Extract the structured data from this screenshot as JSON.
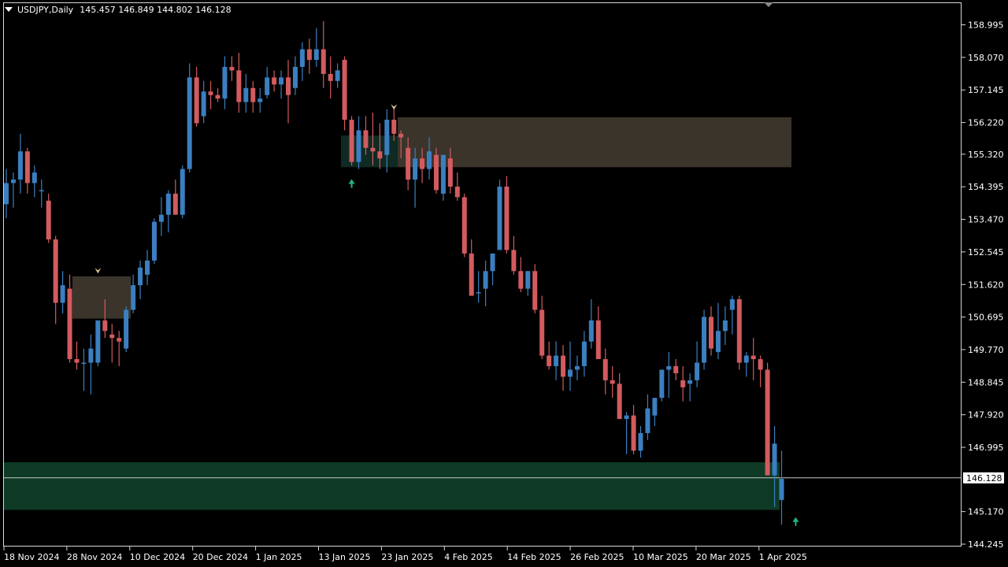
{
  "header": {
    "symbol_tf": "USDJPY,Daily",
    "ohlc": "145.457 146.849 144.802 146.128"
  },
  "colors": {
    "background": "#000000",
    "bull": "#3b7fc0",
    "bear": "#d25b5f",
    "axis": "#d8d8d8",
    "price_line": "#c8c8c8",
    "supply_zone": "#3a342b",
    "demand_zone": "#0e3a25",
    "demand_zone_small": "#0f2a22",
    "up_arrow": "#1fb58a",
    "down_arrow": "#d9c89a"
  },
  "price_axis": {
    "labels": [
      "158.995",
      "158.070",
      "157.145",
      "156.220",
      "155.320",
      "154.395",
      "153.470",
      "152.545",
      "151.620",
      "150.695",
      "149.770",
      "148.845",
      "147.920",
      "146.995",
      "145.170",
      "144.245"
    ],
    "current_price": "146.128"
  },
  "time_axis": {
    "labels": [
      "18 Nov 2024",
      "28 Nov 2024",
      "10 Dec 2024",
      "20 Dec 2024",
      "1 Jan 2025",
      "13 Jan 2025",
      "23 Jan 2025",
      "4 Feb 2025",
      "14 Feb 2025",
      "26 Feb 2025",
      "10 Mar 2025",
      "20 Mar 2025",
      "1 Apr 2025"
    ]
  },
  "chart_data": {
    "type": "candlestick",
    "symbol": "USDJPY",
    "timeframe": "Daily",
    "ylim": [
      144.05,
      159.45
    ],
    "candles": [
      [
        153.9,
        154.9,
        153.5,
        154.5
      ],
      [
        154.5,
        154.8,
        153.8,
        154.6
      ],
      [
        154.6,
        155.9,
        154.2,
        155.4
      ],
      [
        155.4,
        155.5,
        154.2,
        154.5
      ],
      [
        154.5,
        155.0,
        154.1,
        154.8
      ],
      [
        154.3,
        154.6,
        153.8,
        154.3
      ],
      [
        154.0,
        154.2,
        152.8,
        152.9
      ],
      [
        152.9,
        153.0,
        150.5,
        151.1
      ],
      [
        151.1,
        152.0,
        150.8,
        151.6
      ],
      [
        151.5,
        151.9,
        149.4,
        149.5
      ],
      [
        149.5,
        150.0,
        149.2,
        149.4
      ],
      [
        149.4,
        149.8,
        148.6,
        149.4
      ],
      [
        149.4,
        150.2,
        148.5,
        149.8
      ],
      [
        149.4,
        150.4,
        149.3,
        150.6
      ],
      [
        150.6,
        151.2,
        150.1,
        150.3
      ],
      [
        150.2,
        150.5,
        149.4,
        150.1
      ],
      [
        150.1,
        150.3,
        149.3,
        150.0
      ],
      [
        149.8,
        151.0,
        149.7,
        150.9
      ],
      [
        150.9,
        151.9,
        150.8,
        151.6
      ],
      [
        151.6,
        152.3,
        151.2,
        152.1
      ],
      [
        151.9,
        152.6,
        151.6,
        152.3
      ],
      [
        152.3,
        153.5,
        152.2,
        153.4
      ],
      [
        153.4,
        154.1,
        153.0,
        153.6
      ],
      [
        153.6,
        154.3,
        153.1,
        154.2
      ],
      [
        154.2,
        154.6,
        153.6,
        153.6
      ],
      [
        153.6,
        155.0,
        153.5,
        154.9
      ],
      [
        154.9,
        157.9,
        154.8,
        157.5
      ],
      [
        157.5,
        157.8,
        156.1,
        156.2
      ],
      [
        156.4,
        157.4,
        156.2,
        157.1
      ],
      [
        157.1,
        157.4,
        156.6,
        157.0
      ],
      [
        157.0,
        157.2,
        156.8,
        156.9
      ],
      [
        156.9,
        158.1,
        156.6,
        157.8
      ],
      [
        157.8,
        158.1,
        157.4,
        157.7
      ],
      [
        157.7,
        158.2,
        156.5,
        156.8
      ],
      [
        156.8,
        157.6,
        156.5,
        157.2
      ],
      [
        157.2,
        157.4,
        156.5,
        156.8
      ],
      [
        156.8,
        157.2,
        156.5,
        156.9
      ],
      [
        157.0,
        157.8,
        156.9,
        157.5
      ],
      [
        157.5,
        157.7,
        157.1,
        157.3
      ],
      [
        157.3,
        157.7,
        156.9,
        157.5
      ],
      [
        157.5,
        158.0,
        156.2,
        157.0
      ],
      [
        157.2,
        158.1,
        157.0,
        157.8
      ],
      [
        157.8,
        158.5,
        157.4,
        158.3
      ],
      [
        158.3,
        158.6,
        157.6,
        158.0
      ],
      [
        158.0,
        158.9,
        157.8,
        158.3
      ],
      [
        158.3,
        159.1,
        157.2,
        157.6
      ],
      [
        157.6,
        158.1,
        156.9,
        157.4
      ],
      [
        157.4,
        157.9,
        157.2,
        157.7
      ],
      [
        158.0,
        158.1,
        156.0,
        156.3
      ],
      [
        156.3,
        156.4,
        155.0,
        155.1
      ],
      [
        155.1,
        156.4,
        154.9,
        156.0
      ],
      [
        156.0,
        156.4,
        155.3,
        155.5
      ],
      [
        155.5,
        156.5,
        155.0,
        155.4
      ],
      [
        155.4,
        156.2,
        154.9,
        155.2
      ],
      [
        155.3,
        156.6,
        154.8,
        156.3
      ],
      [
        156.3,
        156.6,
        155.7,
        155.9
      ],
      [
        155.9,
        156.0,
        155.2,
        155.8
      ],
      [
        155.5,
        155.8,
        154.3,
        154.6
      ],
      [
        154.6,
        155.5,
        153.8,
        155.2
      ],
      [
        155.2,
        155.5,
        154.5,
        154.9
      ],
      [
        154.9,
        155.8,
        154.6,
        155.4
      ],
      [
        155.3,
        155.5,
        154.2,
        154.3
      ],
      [
        154.2,
        155.3,
        154.0,
        155.3
      ],
      [
        155.2,
        155.5,
        154.2,
        154.4
      ],
      [
        154.4,
        154.8,
        154.0,
        154.1
      ],
      [
        154.1,
        154.2,
        152.4,
        152.5
      ],
      [
        152.5,
        152.9,
        151.3,
        151.3
      ],
      [
        151.4,
        152.0,
        151.1,
        151.4
      ],
      [
        151.5,
        152.3,
        151.0,
        152.0
      ],
      [
        152.0,
        152.4,
        151.6,
        152.5
      ],
      [
        152.6,
        154.6,
        152.6,
        154.4
      ],
      [
        154.4,
        154.7,
        152.5,
        152.6
      ],
      [
        152.6,
        153.0,
        151.9,
        152.0
      ],
      [
        152.0,
        152.4,
        151.4,
        151.5
      ],
      [
        151.5,
        152.0,
        151.3,
        152.0
      ],
      [
        152.0,
        152.2,
        150.8,
        150.9
      ],
      [
        150.9,
        151.3,
        149.5,
        149.6
      ],
      [
        149.6,
        150.0,
        149.2,
        149.3
      ],
      [
        149.3,
        150.0,
        148.9,
        149.6
      ],
      [
        149.6,
        149.9,
        148.6,
        149.0
      ],
      [
        149.0,
        150.0,
        148.6,
        149.2
      ],
      [
        149.2,
        149.6,
        148.9,
        149.3
      ],
      [
        149.3,
        150.3,
        149.0,
        150.0
      ],
      [
        150.0,
        151.2,
        149.8,
        150.6
      ],
      [
        150.6,
        151.0,
        149.5,
        149.5
      ],
      [
        149.5,
        149.8,
        148.5,
        148.9
      ],
      [
        148.9,
        149.3,
        148.4,
        148.8
      ],
      [
        148.8,
        149.1,
        147.8,
        147.8
      ],
      [
        147.8,
        148.0,
        146.8,
        147.9
      ],
      [
        147.9,
        148.2,
        146.8,
        146.9
      ],
      [
        146.9,
        147.6,
        146.7,
        147.4
      ],
      [
        147.4,
        148.5,
        147.2,
        148.1
      ],
      [
        147.9,
        148.3,
        147.6,
        148.4
      ],
      [
        148.4,
        149.2,
        148.3,
        149.2
      ],
      [
        149.2,
        149.7,
        148.4,
        149.3
      ],
      [
        149.3,
        149.5,
        148.9,
        149.1
      ],
      [
        148.9,
        149.3,
        148.3,
        148.7
      ],
      [
        148.8,
        149.1,
        148.3,
        148.9
      ],
      [
        148.9,
        150.0,
        148.7,
        149.4
      ],
      [
        149.4,
        150.9,
        149.2,
        150.7
      ],
      [
        150.7,
        151.0,
        149.6,
        149.8
      ],
      [
        149.7,
        151.1,
        149.5,
        150.3
      ],
      [
        150.3,
        151.0,
        149.9,
        150.6
      ],
      [
        150.9,
        151.3,
        150.2,
        151.2
      ],
      [
        151.2,
        151.3,
        149.2,
        149.4
      ],
      [
        149.4,
        149.7,
        149.0,
        149.6
      ],
      [
        149.6,
        150.1,
        148.9,
        149.5
      ],
      [
        149.5,
        149.6,
        148.7,
        149.2
      ],
      [
        149.2,
        149.4,
        146.5,
        146.2
      ],
      [
        146.2,
        147.6,
        145.3,
        147.1
      ],
      [
        145.5,
        146.9,
        144.8,
        146.1
      ]
    ],
    "zones": [
      {
        "kind": "supply",
        "low": 154.95,
        "high": 156.37
      },
      {
        "kind": "demand",
        "low": 150.65,
        "high": 151.85
      },
      {
        "kind": "demand",
        "low": 145.22,
        "high": 146.57
      },
      {
        "kind": "demand",
        "low": 154.95,
        "high": 155.85
      }
    ],
    "arrows": [
      {
        "kind": "down",
        "candle": 13,
        "price": 152.0
      },
      {
        "kind": "down",
        "candle": 55,
        "price": 156.65
      },
      {
        "kind": "up",
        "candle": 49,
        "price": 154.5
      },
      {
        "kind": "up",
        "candle": 112,
        "price": 144.9
      }
    ],
    "current_price": 146.128,
    "grid": false
  }
}
